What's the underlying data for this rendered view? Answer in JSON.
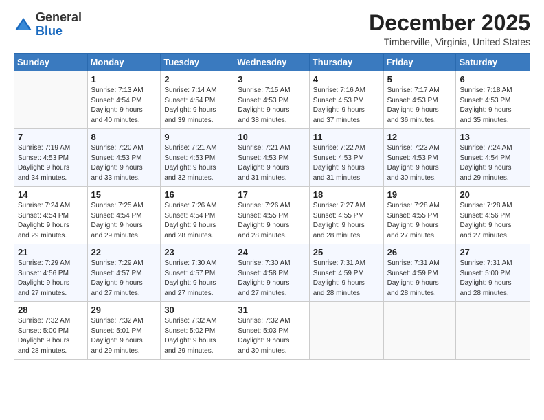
{
  "logo": {
    "general": "General",
    "blue": "Blue"
  },
  "header": {
    "month_year": "December 2025",
    "location": "Timberville, Virginia, United States"
  },
  "days_of_week": [
    "Sunday",
    "Monday",
    "Tuesday",
    "Wednesday",
    "Thursday",
    "Friday",
    "Saturday"
  ],
  "weeks": [
    [
      {
        "day": "",
        "info": ""
      },
      {
        "day": "1",
        "info": "Sunrise: 7:13 AM\nSunset: 4:54 PM\nDaylight: 9 hours\nand 40 minutes."
      },
      {
        "day": "2",
        "info": "Sunrise: 7:14 AM\nSunset: 4:54 PM\nDaylight: 9 hours\nand 39 minutes."
      },
      {
        "day": "3",
        "info": "Sunrise: 7:15 AM\nSunset: 4:53 PM\nDaylight: 9 hours\nand 38 minutes."
      },
      {
        "day": "4",
        "info": "Sunrise: 7:16 AM\nSunset: 4:53 PM\nDaylight: 9 hours\nand 37 minutes."
      },
      {
        "day": "5",
        "info": "Sunrise: 7:17 AM\nSunset: 4:53 PM\nDaylight: 9 hours\nand 36 minutes."
      },
      {
        "day": "6",
        "info": "Sunrise: 7:18 AM\nSunset: 4:53 PM\nDaylight: 9 hours\nand 35 minutes."
      }
    ],
    [
      {
        "day": "7",
        "info": "Sunrise: 7:19 AM\nSunset: 4:53 PM\nDaylight: 9 hours\nand 34 minutes."
      },
      {
        "day": "8",
        "info": "Sunrise: 7:20 AM\nSunset: 4:53 PM\nDaylight: 9 hours\nand 33 minutes."
      },
      {
        "day": "9",
        "info": "Sunrise: 7:21 AM\nSunset: 4:53 PM\nDaylight: 9 hours\nand 32 minutes."
      },
      {
        "day": "10",
        "info": "Sunrise: 7:21 AM\nSunset: 4:53 PM\nDaylight: 9 hours\nand 31 minutes."
      },
      {
        "day": "11",
        "info": "Sunrise: 7:22 AM\nSunset: 4:53 PM\nDaylight: 9 hours\nand 31 minutes."
      },
      {
        "day": "12",
        "info": "Sunrise: 7:23 AM\nSunset: 4:53 PM\nDaylight: 9 hours\nand 30 minutes."
      },
      {
        "day": "13",
        "info": "Sunrise: 7:24 AM\nSunset: 4:54 PM\nDaylight: 9 hours\nand 29 minutes."
      }
    ],
    [
      {
        "day": "14",
        "info": "Sunrise: 7:24 AM\nSunset: 4:54 PM\nDaylight: 9 hours\nand 29 minutes."
      },
      {
        "day": "15",
        "info": "Sunrise: 7:25 AM\nSunset: 4:54 PM\nDaylight: 9 hours\nand 29 minutes."
      },
      {
        "day": "16",
        "info": "Sunrise: 7:26 AM\nSunset: 4:54 PM\nDaylight: 9 hours\nand 28 minutes."
      },
      {
        "day": "17",
        "info": "Sunrise: 7:26 AM\nSunset: 4:55 PM\nDaylight: 9 hours\nand 28 minutes."
      },
      {
        "day": "18",
        "info": "Sunrise: 7:27 AM\nSunset: 4:55 PM\nDaylight: 9 hours\nand 28 minutes."
      },
      {
        "day": "19",
        "info": "Sunrise: 7:28 AM\nSunset: 4:55 PM\nDaylight: 9 hours\nand 27 minutes."
      },
      {
        "day": "20",
        "info": "Sunrise: 7:28 AM\nSunset: 4:56 PM\nDaylight: 9 hours\nand 27 minutes."
      }
    ],
    [
      {
        "day": "21",
        "info": "Sunrise: 7:29 AM\nSunset: 4:56 PM\nDaylight: 9 hours\nand 27 minutes."
      },
      {
        "day": "22",
        "info": "Sunrise: 7:29 AM\nSunset: 4:57 PM\nDaylight: 9 hours\nand 27 minutes."
      },
      {
        "day": "23",
        "info": "Sunrise: 7:30 AM\nSunset: 4:57 PM\nDaylight: 9 hours\nand 27 minutes."
      },
      {
        "day": "24",
        "info": "Sunrise: 7:30 AM\nSunset: 4:58 PM\nDaylight: 9 hours\nand 27 minutes."
      },
      {
        "day": "25",
        "info": "Sunrise: 7:31 AM\nSunset: 4:59 PM\nDaylight: 9 hours\nand 28 minutes."
      },
      {
        "day": "26",
        "info": "Sunrise: 7:31 AM\nSunset: 4:59 PM\nDaylight: 9 hours\nand 28 minutes."
      },
      {
        "day": "27",
        "info": "Sunrise: 7:31 AM\nSunset: 5:00 PM\nDaylight: 9 hours\nand 28 minutes."
      }
    ],
    [
      {
        "day": "28",
        "info": "Sunrise: 7:32 AM\nSunset: 5:00 PM\nDaylight: 9 hours\nand 28 minutes."
      },
      {
        "day": "29",
        "info": "Sunrise: 7:32 AM\nSunset: 5:01 PM\nDaylight: 9 hours\nand 29 minutes."
      },
      {
        "day": "30",
        "info": "Sunrise: 7:32 AM\nSunset: 5:02 PM\nDaylight: 9 hours\nand 29 minutes."
      },
      {
        "day": "31",
        "info": "Sunrise: 7:32 AM\nSunset: 5:03 PM\nDaylight: 9 hours\nand 30 minutes."
      },
      {
        "day": "",
        "info": ""
      },
      {
        "day": "",
        "info": ""
      },
      {
        "day": "",
        "info": ""
      }
    ]
  ]
}
